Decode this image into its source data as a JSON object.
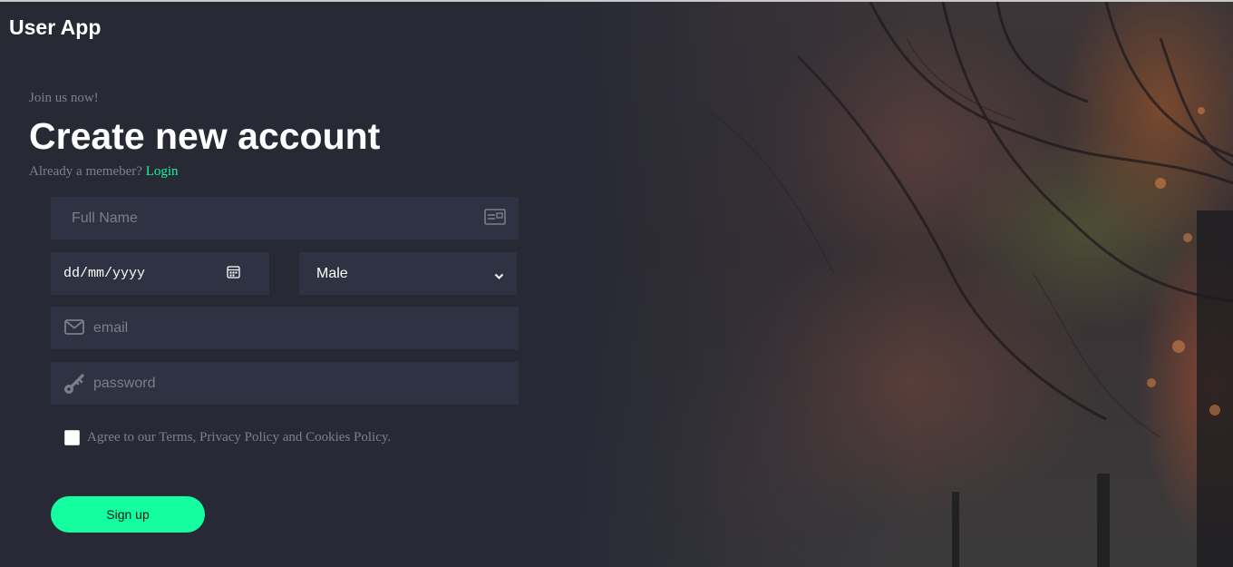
{
  "app": {
    "title": "User App"
  },
  "form": {
    "tagline": "Join us now!",
    "heading": "Create new account",
    "member_prompt": "Already a memeber?",
    "login_link": "Login",
    "full_name": {
      "placeholder": "Full Name",
      "icon": "id-card-icon"
    },
    "birth_date": {
      "value": "dd/mm/yyyy",
      "icon": "calendar-icon"
    },
    "gender": {
      "selected": "Male",
      "icon": "chevron-down-icon"
    },
    "email": {
      "placeholder": "email",
      "icon": "envelope-icon"
    },
    "password": {
      "placeholder": "password",
      "icon": "key-icon"
    },
    "agree_text": "Agree to our Terms, Privacy Policy and Cookies Policy.",
    "agree_checked": false,
    "submit_label": "Sign up"
  },
  "colors": {
    "background": "#272935",
    "field": "#2f3242",
    "accent": "#14fd9f",
    "muted_text": "#7e808c"
  }
}
